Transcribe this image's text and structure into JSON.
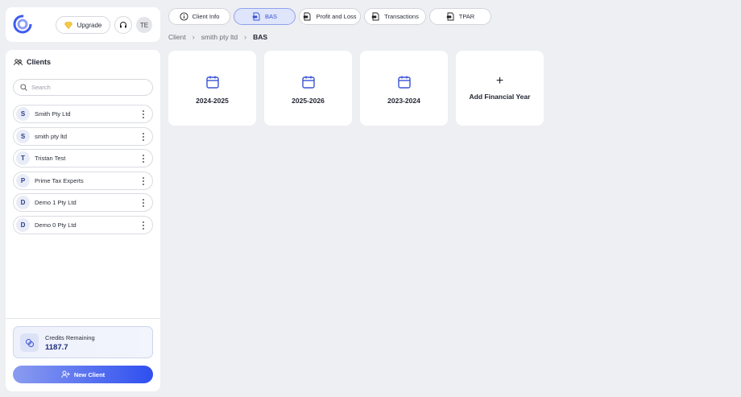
{
  "header": {
    "upgrade_label": "Upgrade",
    "avatar_initials": "TE"
  },
  "sidebar": {
    "title": "Clients",
    "search_placeholder": "Search",
    "clients": [
      {
        "initial": "S",
        "name": "Smith Pty Ltd"
      },
      {
        "initial": "S",
        "name": "smith pty ltd"
      },
      {
        "initial": "T",
        "name": "Tristan Test"
      },
      {
        "initial": "P",
        "name": "Prime Tax Experts"
      },
      {
        "initial": "D",
        "name": "Demo 1 Pty Ltd"
      },
      {
        "initial": "D",
        "name": "Demo 0 Pty Ltd"
      }
    ],
    "credits_label": "Credits Remaining",
    "credits_value": "1187.7",
    "new_client_label": "New Client"
  },
  "tabs": [
    {
      "label": "Client Info",
      "icon": "info-icon",
      "active": false
    },
    {
      "label": "BAS",
      "icon": "document-icon",
      "active": true
    },
    {
      "label": "Profit and Loss",
      "icon": "document-icon",
      "active": false
    },
    {
      "label": "Transactions",
      "icon": "document-icon",
      "active": false
    },
    {
      "label": "TPAR",
      "icon": "document-icon",
      "active": false
    }
  ],
  "breadcrumb": {
    "items": [
      "Client",
      "smith pty ltd"
    ],
    "current": "BAS"
  },
  "financial_years": [
    "2024-2025",
    "2025-2026",
    "2023-2024"
  ],
  "add_year_label": "Add Financial Year",
  "colors": {
    "accent": "#2f4ff0",
    "active_tab_bg": "#dfe5fb",
    "background": "#eeeff2"
  }
}
